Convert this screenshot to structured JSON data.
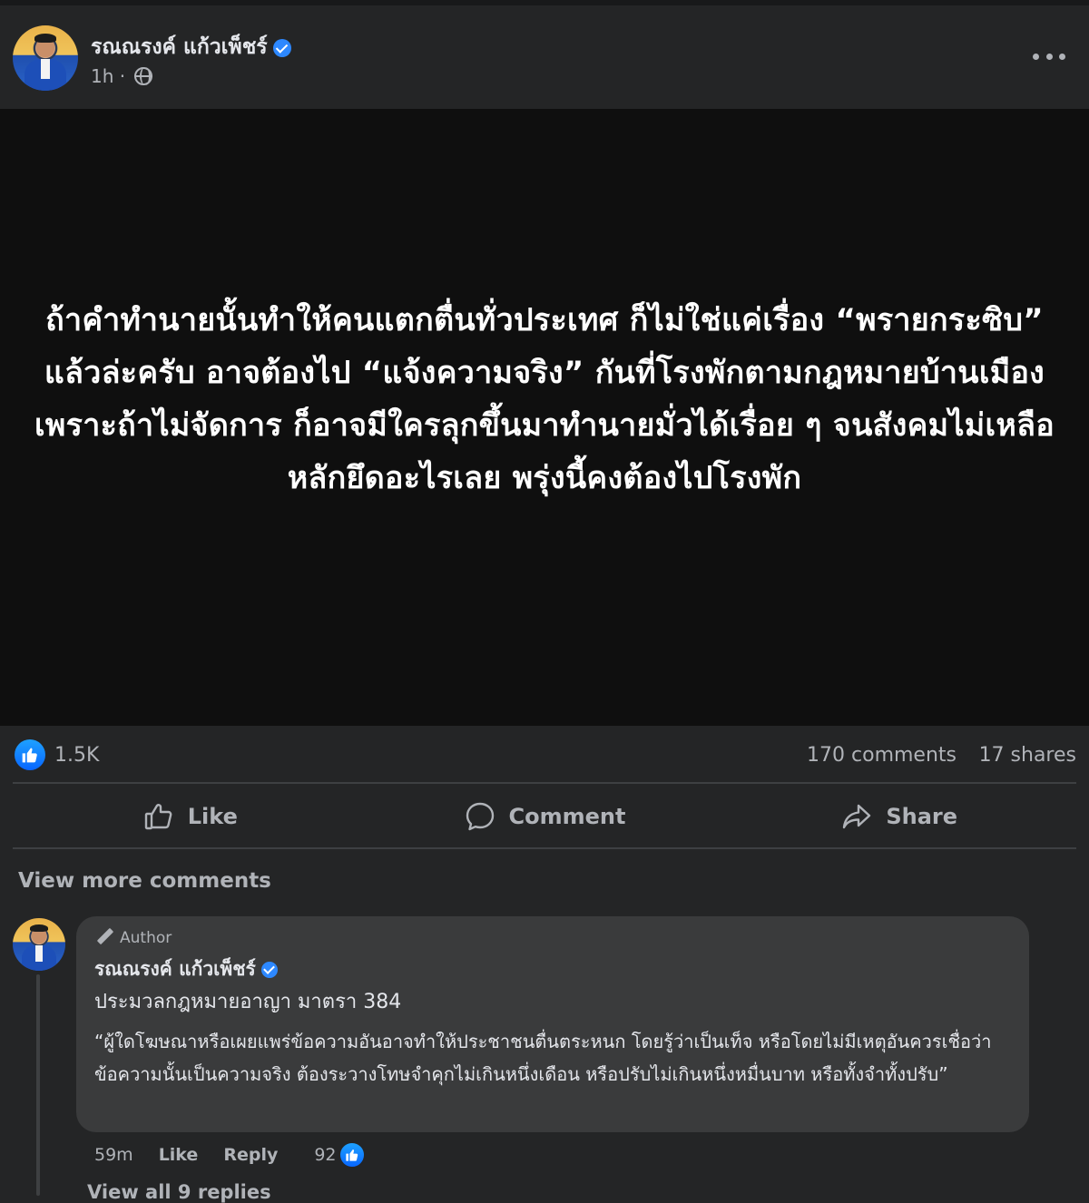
{
  "post": {
    "author": "รณณรงค์ แก้วเพ็ชร์",
    "time": "1h",
    "separator": "·",
    "image_text": "ถ้าคำทำนายนั้นทำให้คนแตกตื่นทั่วประเทศ ก็ไม่ใช่แค่เรื่อง “พรายกระซิบ” แล้วล่ะครับ อาจต้องไป “แจ้งความจริง” กันที่โรงพักตามกฎหมายบ้านเมือง เพราะถ้าไม่จัดการ ก็อาจมีใครลุกขึ้นมาทำนายมั่วได้เรื่อย ๆ จนสังคมไม่เหลือหลักยึดอะไรเลย พรุ่งนี้คงต้องไปโรงพัก"
  },
  "stats": {
    "reactions": "1.5K",
    "comments": "170 comments",
    "shares": "17 shares"
  },
  "actions": {
    "like": "Like",
    "comment": "Comment",
    "share": "Share"
  },
  "view_more_comments": "View more comments",
  "comment": {
    "badge": "Author",
    "author": "รณณรงค์ แก้วเพ็ชร์",
    "line1": "ประมวลกฎหมายอาญา มาตรา 384",
    "quote": "“ผู้ใดโฆษณาหรือเผยแพร่ข้อความอันอาจทำให้ประชาชนตื่นตระหนก โดยรู้ว่าเป็นเท็จ หรือโดยไม่มีเหตุอันควรเชื่อว่าข้อความนั้นเป็นความจริง ต้องระวางโทษจำคุกไม่เกินหนึ่งเดือน หรือปรับไม่เกินหนึ่งหมื่นบาท หรือทั้งจำทั้งปรับ”",
    "time": "59m",
    "like": "Like",
    "reply": "Reply",
    "reaction_count": "92",
    "view_replies": "View all 9 replies"
  },
  "colors": {
    "background": "#242526",
    "image_background": "#0f0f0f",
    "bubble": "#3a3b3c",
    "accent_blue": "#0866ff",
    "secondary_text": "#b0b3b8"
  },
  "icons": {
    "verified": "verified-badge-icon",
    "audience": "globe-icon",
    "menu": "more-horizontal-icon",
    "reaction": "thumbs-up-icon",
    "comment": "speech-bubble-icon",
    "share": "share-arrow-icon",
    "author_badge": "pencil-icon"
  }
}
